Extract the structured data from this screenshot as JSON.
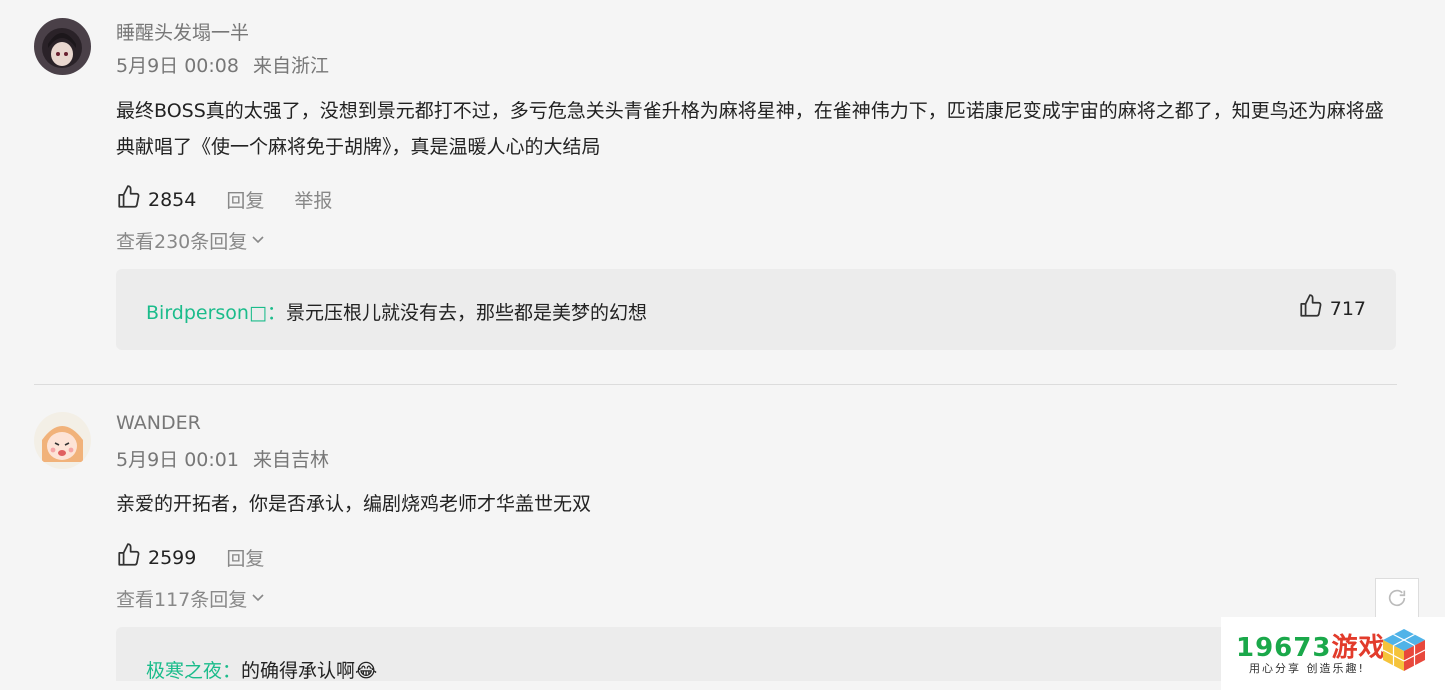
{
  "comments": [
    {
      "username": "睡醒头发塌一半",
      "date": "5月9日 00:08",
      "location": "来自浙江",
      "content": "最终BOSS真的太强了，没想到景元都打不过，多亏危急关头青雀升格为麻将星神，在雀神伟力下，匹诺康尼变成宇宙的麻将之都了，知更鸟还为麻将盛典献唱了《使一个麻将免于胡牌》，真是温暖人心的大结局",
      "likes": "2854",
      "reply_label": "回复",
      "report_label": "举报",
      "view_replies": "查看230条回复",
      "reply": {
        "author": "Birdperson□：",
        "text": "景元压根儿就没有去，那些都是美梦的幻想",
        "likes": "717"
      }
    },
    {
      "username": "WANDER",
      "date": "5月9日 00:01",
      "location": "来自吉林",
      "content": "亲爱的开拓者，你是否承认，编剧烧鸡老师才华盖世无双",
      "likes": "2599",
      "reply_label": "回复",
      "view_replies": "查看117条回复",
      "reply": {
        "author": "极寒之夜：",
        "text": "的确得承认啊😂"
      }
    }
  ],
  "watermark": {
    "number": "19673",
    "name": "游戏",
    "slogan": "用心分享 创造乐趣!"
  },
  "colors": {
    "accent": "#1bbc8b",
    "background": "#f5f5f5",
    "reply_bg": "#ececec"
  },
  "icons": [
    "thumbs-up-icon",
    "chevron-down-icon",
    "refresh-icon"
  ]
}
